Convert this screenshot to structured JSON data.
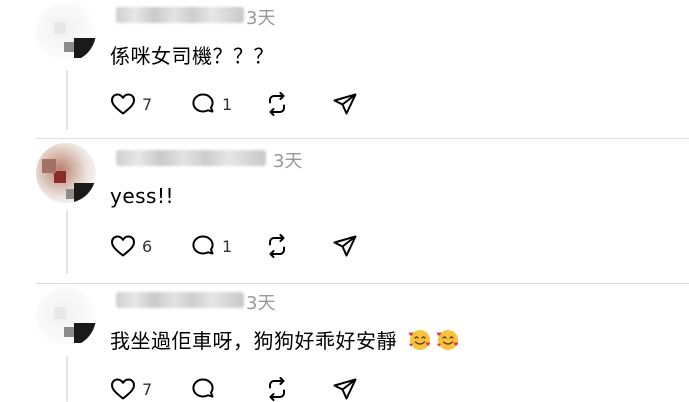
{
  "comments": [
    {
      "time": "3天",
      "text": "係咪女司機？？？",
      "likes": "7",
      "replies": "1",
      "emoji_icons": []
    },
    {
      "time": "3天",
      "text": "yess!!",
      "likes": "6",
      "replies": "1",
      "emoji_icons": []
    },
    {
      "time": "3天",
      "text": "我坐過佢車呀，狗狗好乖好安靜",
      "likes": "7",
      "replies": "",
      "emoji_icons": [
        "smiling-face-with-hearts-icon",
        "smiling-face-with-hearts-icon"
      ]
    }
  ],
  "icons": {
    "like": "heart-icon",
    "reply": "speech-bubble-icon",
    "repost": "repost-arrows-icon",
    "share": "paper-plane-icon"
  },
  "colors": {
    "text": "#000000",
    "muted": "#999999",
    "icon": "#000000",
    "divider": "#dddddd"
  }
}
